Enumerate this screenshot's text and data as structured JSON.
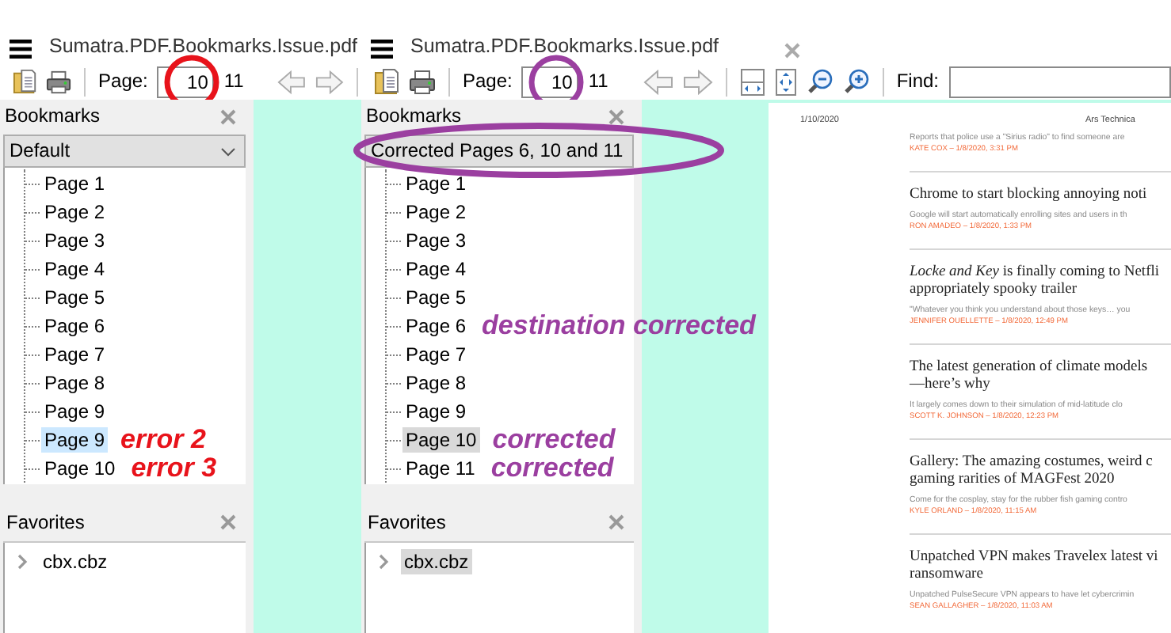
{
  "windows": [
    {
      "title": "Sumatra.PDF.Bookmarks.Issue.pdf",
      "closable": false,
      "toolbar": {
        "page_label": "Page:",
        "page_value": "10",
        "page_mark": {
          "color": "#e8131b"
        },
        "page_count": "11",
        "view_tools": false
      },
      "bookmarks": {
        "title": "Bookmarks",
        "focused": true,
        "dropdown": {
          "value": "Default"
        },
        "items": [
          {
            "label": "Page 1",
            "selected": false
          },
          {
            "label": "Page 2",
            "selected": false
          },
          {
            "label": "Page 3",
            "selected": false
          },
          {
            "label": "Page 4",
            "selected": false
          },
          {
            "label": "Page 5",
            "selected": false
          },
          {
            "label": "Page 6",
            "selected": false
          },
          {
            "label": "Page 7",
            "selected": false
          },
          {
            "label": "Page 8",
            "selected": false
          },
          {
            "label": "Page 9",
            "selected": false
          },
          {
            "label": "Page 9",
            "selected": true,
            "note": {
              "text": "error 2",
              "color": "#e8131b"
            }
          },
          {
            "label": "Page 10",
            "selected": false,
            "note": {
              "text": "error 3",
              "color": "#e8131b"
            }
          }
        ]
      },
      "favorites": {
        "title": "Favorites",
        "items": [
          {
            "label": "cbx.cbz",
            "selected": false
          }
        ]
      }
    },
    {
      "title": "Sumatra.PDF.Bookmarks.Issue.pdf",
      "closable": true,
      "toolbar": {
        "page_label": "Page:",
        "page_value": "10",
        "page_mark": {
          "color": "#9b3fa0"
        },
        "page_count": "11",
        "view_tools": true,
        "find_label": "Find:"
      },
      "bookmarks": {
        "title": "Bookmarks",
        "focused": false,
        "dropdown": {
          "value": "Corrected Pages 6, 10 and 11",
          "mark": {
            "color": "#9b3fa0"
          }
        },
        "items": [
          {
            "label": "Page 1",
            "selected": false
          },
          {
            "label": "Page 2",
            "selected": false
          },
          {
            "label": "Page 3",
            "selected": false
          },
          {
            "label": "Page 4",
            "selected": false
          },
          {
            "label": "Page 5",
            "selected": false
          },
          {
            "label": "Page 6",
            "selected": false,
            "note": {
              "text": "destination corrected",
              "color": "#9b3fa0"
            }
          },
          {
            "label": "Page 7",
            "selected": false
          },
          {
            "label": "Page 8",
            "selected": false
          },
          {
            "label": "Page 9",
            "selected": false
          },
          {
            "label": "Page 10",
            "selected": true,
            "note": {
              "text": "corrected",
              "color": "#9b3fa0"
            }
          },
          {
            "label": "Page 11",
            "selected": false,
            "note": {
              "text": "corrected",
              "color": "#9b3fa0"
            }
          }
        ]
      },
      "favorites": {
        "title": "Favorites",
        "items": [
          {
            "label": "cbx.cbz",
            "selected": true
          }
        ]
      },
      "document": {
        "date": "1/10/2020",
        "site": "Ars Technica",
        "articles": [
          {
            "summary": "Reports that police use a \"Sirius radio\" to find someone are",
            "byline": "KATE COX – 1/8/2020, 3:31 PM"
          },
          {
            "headline": [
              "Chrome to start blocking annoying noti"
            ],
            "summary": "Google will start automatically enrolling sites and users in th",
            "byline": "RON AMADEO – 1/8/2020, 1:33 PM"
          },
          {
            "headline": [
              "*Locke and Key* is finally coming to Netfli",
              "appropriately spooky trailer"
            ],
            "summary": "\"Whatever you think you understand about those keys… you",
            "byline": "JENNIFER OUELLETTE – 1/8/2020, 12:49 PM"
          },
          {
            "headline": [
              "The latest generation of climate models",
              "—here’s why"
            ],
            "summary": "It largely comes down to their simulation of mid-latitude clo",
            "byline": "SCOTT K. JOHNSON – 1/8/2020, 12:23 PM"
          },
          {
            "headline": [
              "Gallery: The amazing costumes, weird c",
              "gaming rarities of MAGFest 2020"
            ],
            "summary": "Come for the cosplay, stay for the rubber fish gaming contro",
            "byline": "KYLE ORLAND – 1/8/2020, 11:15 AM"
          },
          {
            "headline": [
              "Unpatched VPN makes Travelex latest vi",
              "ransomware"
            ],
            "summary": "Unpatched PulseSecure VPN appears to have let cybercrimin",
            "byline": "SEAN GALLAGHER – 1/8/2020, 11:03 AM"
          }
        ]
      }
    }
  ]
}
